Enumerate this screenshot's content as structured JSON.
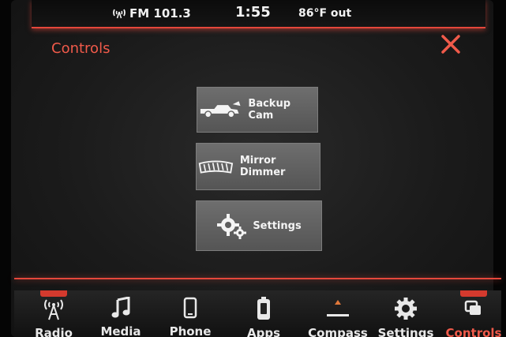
{
  "status_bar": {
    "radio": "FM 101.3",
    "time": "1:55",
    "temperature": "86°F out"
  },
  "header": {
    "title": "Controls"
  },
  "menu": {
    "backup_cam": "Backup Cam",
    "mirror_dimmer": "Mirror Dimmer",
    "settings": "Settings"
  },
  "nav": {
    "items": [
      {
        "label": "Radio",
        "icon": "radio-tower-icon"
      },
      {
        "label": "Media",
        "icon": "music-note-icon"
      },
      {
        "label": "Phone",
        "icon": "phone-icon"
      },
      {
        "label": "Apps",
        "icon": "apps-icon"
      },
      {
        "label": "Compass",
        "icon": "compass-icon"
      },
      {
        "label": "Settings",
        "icon": "gear-icon"
      },
      {
        "label": "Controls",
        "icon": "controls-icon"
      }
    ],
    "active": "Controls"
  },
  "colors": {
    "accent": "#e5473b",
    "button": "#666666",
    "text": "#f2f2f2"
  }
}
